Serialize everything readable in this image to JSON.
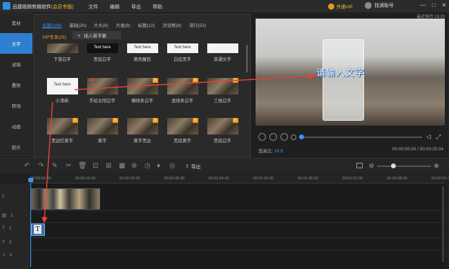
{
  "app": {
    "title": "迅捷视频剪辑软件",
    "edition": "(会员专版)",
    "menu": [
      "文件",
      "编辑",
      "导出",
      "帮助"
    ],
    "vip_label": "开通VIP",
    "account_label": "找滴账号",
    "window_controls": [
      "—",
      "□",
      "✕"
    ],
    "save_time": "最近保存 18:20"
  },
  "nav": {
    "items": [
      {
        "label": "素材",
        "active": false
      },
      {
        "label": "文字",
        "active": true
      },
      {
        "label": "滤镜",
        "active": false
      },
      {
        "label": "叠附",
        "active": false
      },
      {
        "label": "转场",
        "active": false
      },
      {
        "label": "动画",
        "active": false
      },
      {
        "label": "配乐",
        "active": false
      }
    ]
  },
  "library": {
    "tabs": [
      {
        "label": "全部(106)",
        "active": true
      },
      {
        "label": "基础(20)"
      },
      {
        "label": "片头(8)"
      },
      {
        "label": "片尾(8)"
      },
      {
        "label": "标题(12)"
      },
      {
        "label": "对话框(6)"
      },
      {
        "label": "流行(52)"
      }
    ],
    "vip_tab": "VIP专享(25)",
    "insert_subtitle": "插入新字幕",
    "insert_icon": "plus-icon",
    "rows": [
      [
        {
          "label": "下落白字",
          "thumb": "photo",
          "sample": ""
        },
        {
          "label": "黑底白字",
          "thumb": "dark",
          "sample": "Text here"
        },
        {
          "label": "黄色醒目",
          "thumb": "light",
          "sample": "Text here"
        },
        {
          "label": "白底黑字",
          "thumb": "light",
          "sample": "Text here"
        },
        {
          "label": "普通文字",
          "thumb": "light",
          "sample": ""
        }
      ],
      [
        {
          "label": "小清新",
          "thumb": "light",
          "sample": "Text here"
        },
        {
          "label": "手绘太阳白字",
          "thumb": "photo",
          "sample": "",
          "vip": "VIP"
        },
        {
          "label": "横线条白字",
          "thumb": "photo",
          "sample": "",
          "dl": true
        },
        {
          "label": "竖线条白字",
          "thumb": "photo",
          "sample": "",
          "dl": true
        },
        {
          "label": "三维白字",
          "thumb": "photo",
          "sample": "",
          "dl": true
        }
      ],
      [
        {
          "label": "黑边红黄字",
          "thumb": "photo",
          "sample": "",
          "dl": true
        },
        {
          "label": "黄字",
          "thumb": "photo",
          "sample": "",
          "dl": true
        },
        {
          "label": "黄字黑边",
          "thumb": "photo",
          "sample": "",
          "dl": true
        },
        {
          "label": "黑底黄字",
          "thumb": "photo",
          "sample": "",
          "dl": true
        },
        {
          "label": "黑底白字",
          "thumb": "photo",
          "sample": "",
          "dl": true
        }
      ]
    ]
  },
  "preview": {
    "overlay_text": "请输入文字"
  },
  "player": {
    "ratio_label": "宽高比:",
    "ratio_value": "16:9",
    "timecode": "00:00:00.00 / 00:00:25.04",
    "progress_fraction": 0.0
  },
  "toolbar": {
    "export_label": "导出",
    "zoom_fraction": 0.3
  },
  "timeline": {
    "ticks": [
      "00:00:00.00",
      "00:00:16.00",
      "00:00:32.00",
      "00:00:48.00",
      "00:01:04.00",
      "00:01:20.00",
      "00:01:36.00",
      "00:01:52.00",
      "00:02:08.00",
      "00:02:24.00"
    ],
    "track_heads": [
      {
        "icon": "video-track-icon",
        "label": ""
      },
      {
        "icon": "image-track-icon",
        "label": "1"
      },
      {
        "icon": "text-track-icon",
        "label": "1"
      },
      {
        "icon": "text-track-icon",
        "label": "2"
      },
      {
        "icon": "music-track-icon",
        "label": "1"
      }
    ],
    "text_clip_letter": "T"
  },
  "colors": {
    "accent": "#3a97ff",
    "annotation_arrow": "#e8413b",
    "vip": "#f0c040"
  }
}
